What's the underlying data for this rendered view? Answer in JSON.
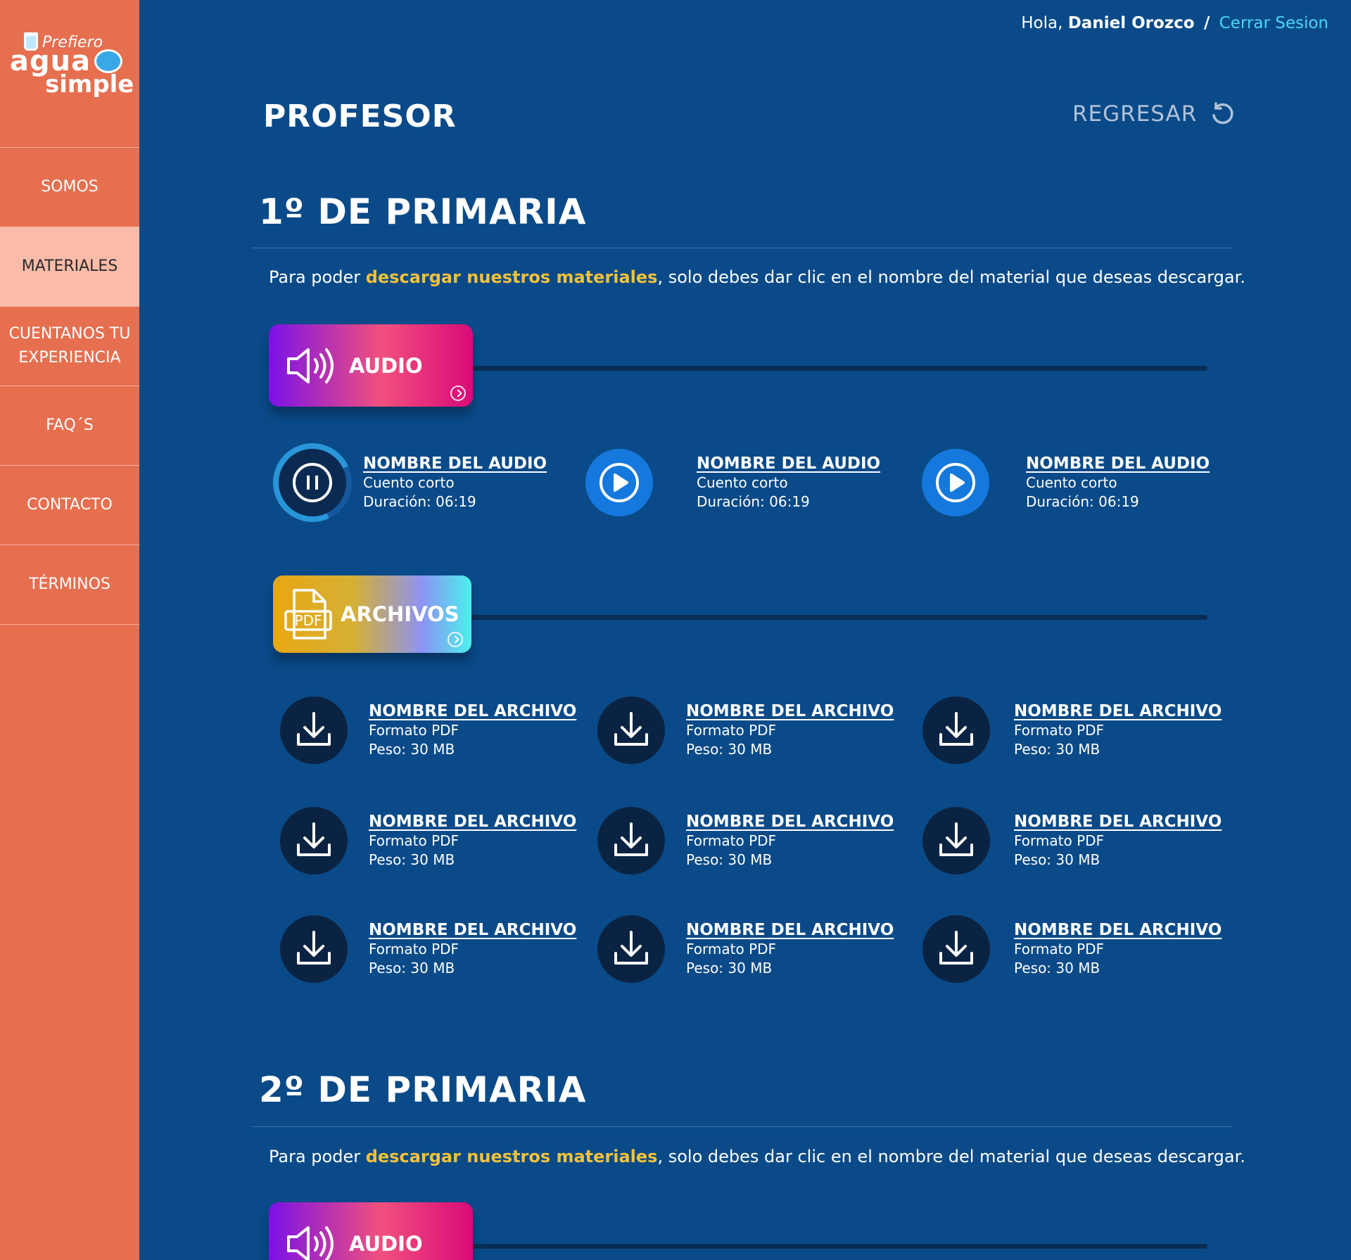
{
  "sidebar": {
    "logo": {
      "small": "Prefiero",
      "big1": "agua",
      "big2": "simple"
    },
    "items": [
      {
        "label": "SOMOS"
      },
      {
        "label": "MATERIALES"
      },
      {
        "label": "CUENTANOS TU EXPERIENCIA"
      },
      {
        "label": "FAQ´S"
      },
      {
        "label": "CONTACTO"
      },
      {
        "label": "TÉRMINOS"
      }
    ]
  },
  "topbar": {
    "greeting": "Hola,",
    "user": "Daniel Orozco",
    "separator": "/",
    "logout": "Cerrar Sesion"
  },
  "header": {
    "title": "PROFESOR",
    "back_label": "REGRESAR"
  },
  "intro": {
    "pre": "Para poder ",
    "highlight": "descargar nuestros materiales",
    "post": ", solo debes dar clic en el nombre del material que deseas descargar."
  },
  "categories": {
    "audio": "AUDIO",
    "files": "ARCHIVOS",
    "pdf_tag": "PDF"
  },
  "sections": [
    {
      "title": "1º DE PRIMARIA",
      "audios": [
        {
          "name": "NOMBRE DEL AUDIO",
          "type": "Cuento corto",
          "duration_label": "Duración:",
          "duration": "06:19",
          "state": "playing"
        },
        {
          "name": "NOMBRE DEL AUDIO",
          "type": "Cuento corto",
          "duration_label": "Duración:",
          "duration": "06:19",
          "state": "paused"
        },
        {
          "name": "NOMBRE DEL AUDIO",
          "type": "Cuento corto",
          "duration_label": "Duración:",
          "duration": "06:19",
          "state": "paused"
        }
      ],
      "files": [
        {
          "name": "NOMBRE DEL ARCHIVO",
          "format": "Formato PDF",
          "size_label": "Peso:",
          "size": "30 MB"
        },
        {
          "name": "NOMBRE DEL ARCHIVO",
          "format": "Formato PDF",
          "size_label": "Peso:",
          "size": "30 MB"
        },
        {
          "name": "NOMBRE DEL ARCHIVO",
          "format": "Formato PDF",
          "size_label": "Peso:",
          "size": "30 MB"
        },
        {
          "name": "NOMBRE DEL ARCHIVO",
          "format": "Formato PDF",
          "size_label": "Peso:",
          "size": "30 MB"
        },
        {
          "name": "NOMBRE DEL ARCHIVO",
          "format": "Formato PDF",
          "size_label": "Peso:",
          "size": "30 MB"
        },
        {
          "name": "NOMBRE DEL ARCHIVO",
          "format": "Formato PDF",
          "size_label": "Peso:",
          "size": "30 MB"
        },
        {
          "name": "NOMBRE DEL ARCHIVO",
          "format": "Formato PDF",
          "size_label": "Peso:",
          "size": "30 MB"
        },
        {
          "name": "NOMBRE DEL ARCHIVO",
          "format": "Formato PDF",
          "size_label": "Peso:",
          "size": "30 MB"
        },
        {
          "name": "NOMBRE DEL ARCHIVO",
          "format": "Formato PDF",
          "size_label": "Peso:",
          "size": "30 MB"
        }
      ]
    },
    {
      "title": "2º DE PRIMARIA"
    }
  ],
  "colors": {
    "background": "#0a4a88",
    "sidebar": "#e66f4f",
    "sidebar_active": "#fbbba9",
    "highlight": "#f3c23b",
    "logout_link": "#4cd6f3",
    "play_button": "#1578dc"
  },
  "icons": {
    "audio_category": "speaker-icon",
    "files_category": "pdf-file-icon",
    "back": "undo-arrow-icon",
    "play": "play-icon",
    "pause": "pause-icon",
    "download": "download-icon"
  }
}
